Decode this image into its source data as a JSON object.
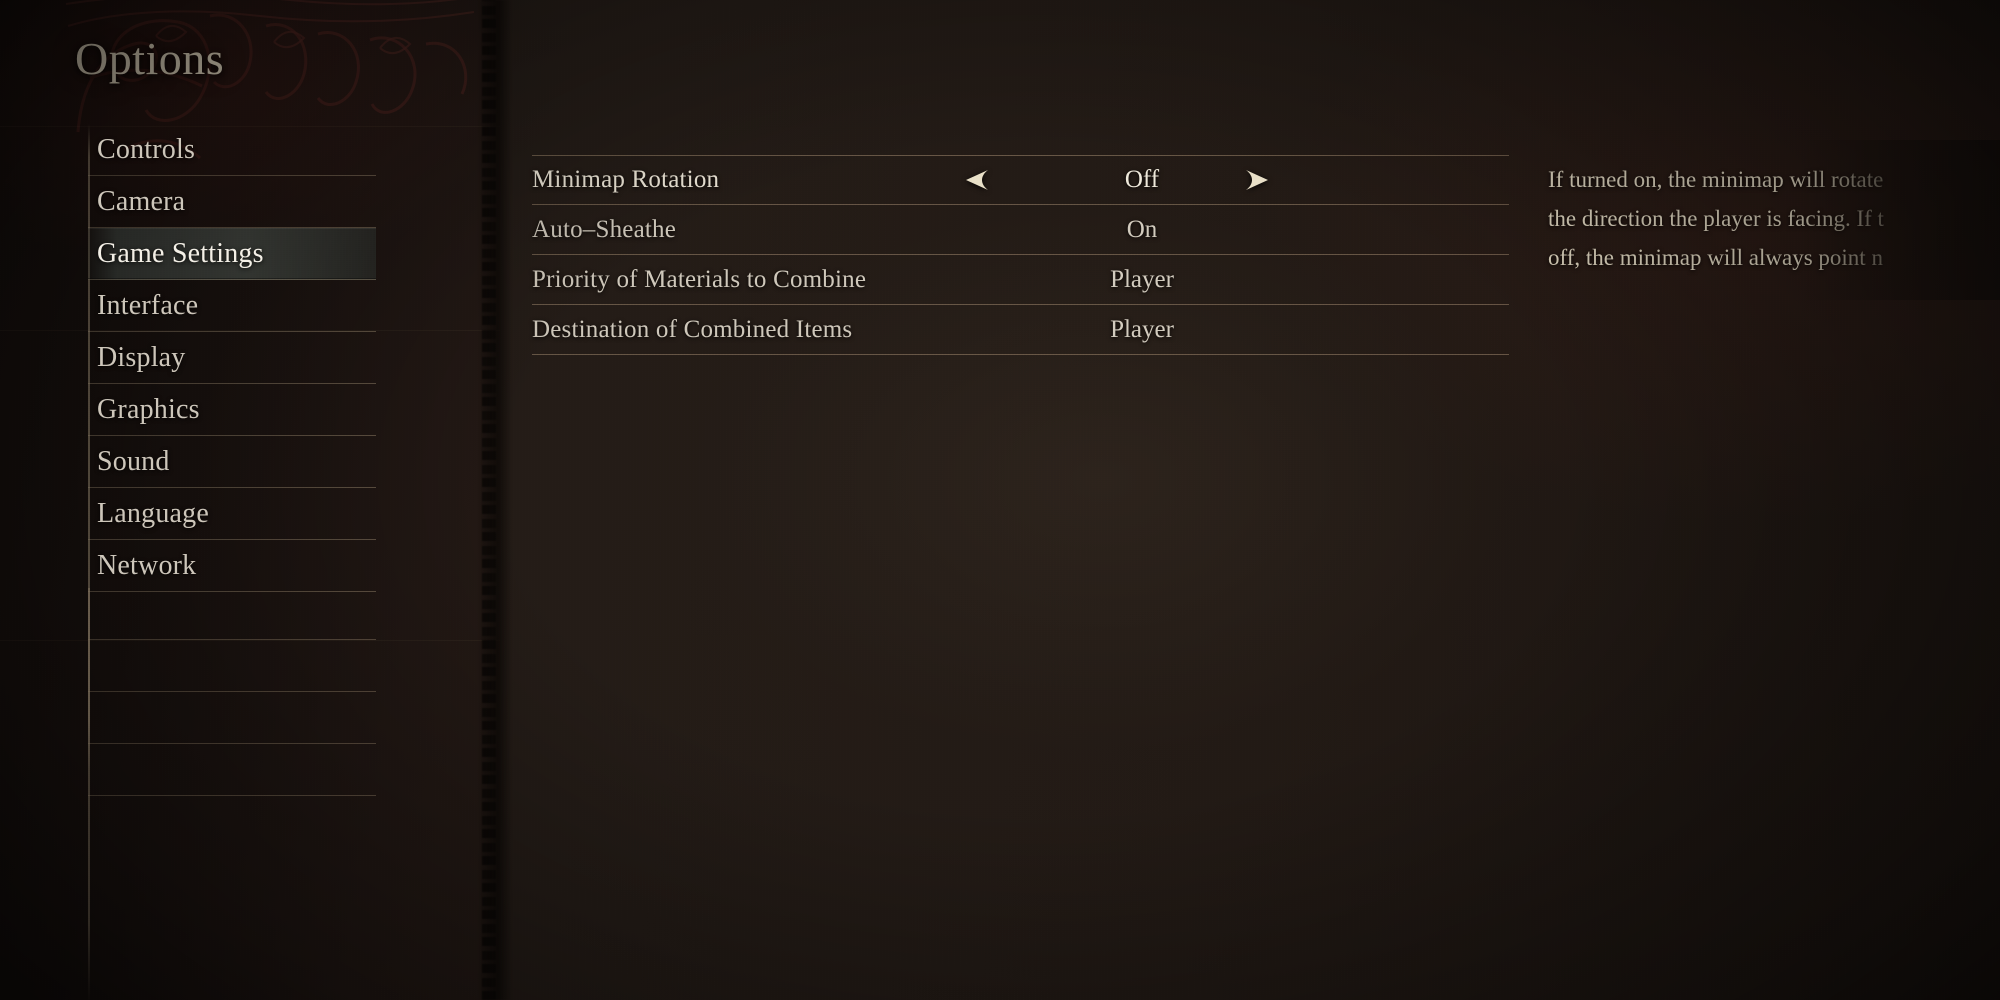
{
  "header": {
    "title": "Options"
  },
  "sidebar": {
    "items": [
      {
        "label": "Controls",
        "selected": false
      },
      {
        "label": "Camera",
        "selected": false
      },
      {
        "label": "Game Settings",
        "selected": true
      },
      {
        "label": "Interface",
        "selected": false
      },
      {
        "label": "Display",
        "selected": false
      },
      {
        "label": "Graphics",
        "selected": false
      },
      {
        "label": "Sound",
        "selected": false
      },
      {
        "label": "Language",
        "selected": false
      },
      {
        "label": "Network",
        "selected": false
      }
    ],
    "empty_rows": 4
  },
  "settings": {
    "rows": [
      {
        "label": "Minimap Rotation",
        "value": "Off",
        "active": true,
        "left_arrow": "triangle-left-icon",
        "right_arrow": "triangle-right-icon"
      },
      {
        "label": "Auto–Sheathe",
        "value": "On",
        "active": false
      },
      {
        "label": "Priority of Materials to Combine",
        "value": "Player",
        "active": false
      },
      {
        "label": "Destination of Combined Items",
        "value": "Player",
        "active": false
      }
    ]
  },
  "description": {
    "lines": [
      "If turned on, the minimap will rotate",
      "the direction the player is facing. If t",
      "off, the minimap will always point n"
    ]
  },
  "colors": {
    "background": "#241c17",
    "panel_dark": "#1b1310",
    "text_primary": "#cfc8bb",
    "text_title": "#e7dcc4",
    "accent_line": "#baa080",
    "selected_row": "#464a44",
    "arrow": "#e9e0c8"
  }
}
